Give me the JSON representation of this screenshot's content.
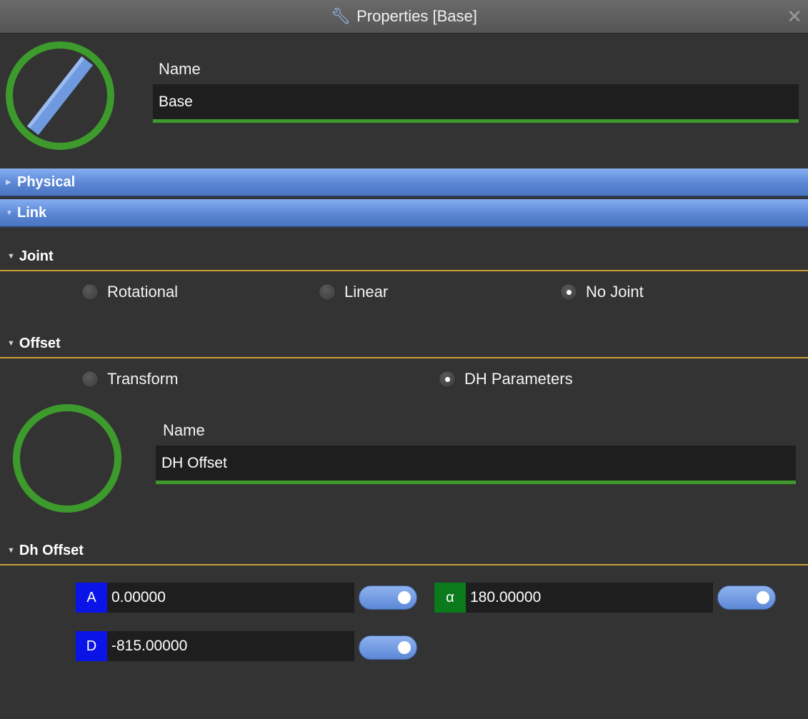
{
  "window": {
    "title": "Properties [Base]",
    "title_icon": "wrench-icon",
    "close_glyph": "✕"
  },
  "name_section": {
    "label": "Name",
    "value": "Base",
    "avatar_icon": "link-icon",
    "accent_color": "#3d9a2c"
  },
  "sections": {
    "physical": "Physical",
    "link": "Link",
    "joint": "Joint",
    "offset": "Offset",
    "dh_offset": "Dh Offset"
  },
  "joint": {
    "options": [
      "Rotational",
      "Linear",
      "No Joint"
    ],
    "selected": "No Joint"
  },
  "offset": {
    "options": [
      "Transform",
      "DH Parameters"
    ],
    "selected": "DH Parameters",
    "name_label": "Name",
    "name_value": "DH Offset"
  },
  "dh_params": {
    "a": {
      "tag": "A",
      "value": "0.00000",
      "tag_color": "#0a14e6",
      "enabled": true
    },
    "alpha": {
      "tag": "α",
      "value": "180.00000",
      "tag_color": "#0a7a1a",
      "enabled": true
    },
    "d": {
      "tag": "D",
      "value": "-815.00000",
      "tag_color": "#0a14e6",
      "enabled": true
    }
  },
  "colors": {
    "header_blue": "#5a86d4",
    "section_underline": "#c9a032",
    "background": "#333333"
  }
}
